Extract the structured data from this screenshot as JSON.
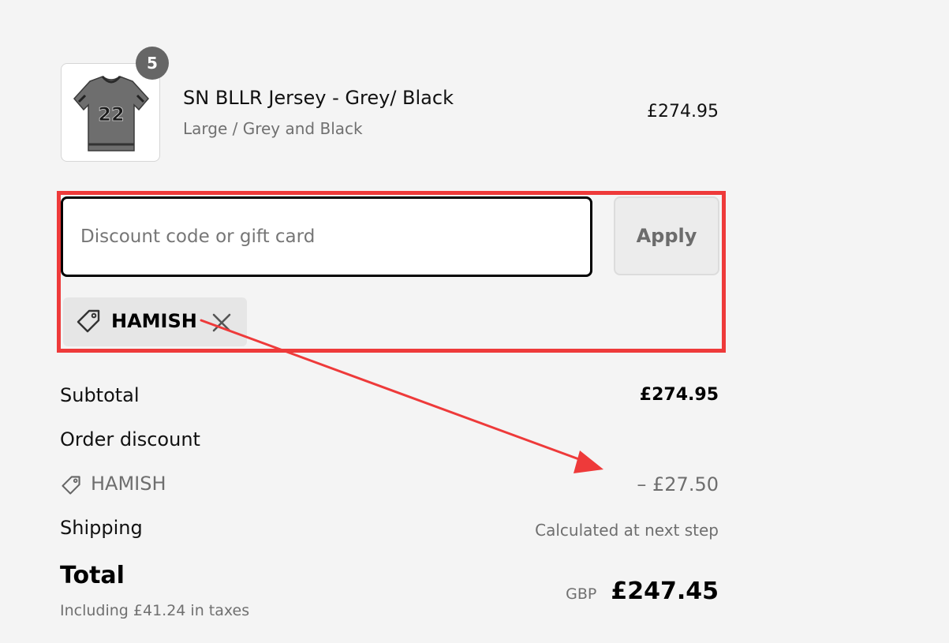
{
  "product": {
    "quantity": "5",
    "name": "SN BLLR Jersey - Grey/ Black",
    "variant": "Large / Grey and Black",
    "price": "£274.95",
    "jersey_number": "22"
  },
  "discount": {
    "placeholder": "Discount code or gift card",
    "value": "",
    "apply_label": "Apply",
    "applied_code": "HAMISH"
  },
  "summary": {
    "subtotal_label": "Subtotal",
    "subtotal_value": "£274.95",
    "order_discount_label": "Order discount",
    "discount_code": "HAMISH",
    "discount_amount": "– £27.50",
    "shipping_label": "Shipping",
    "shipping_value": "Calculated at next step",
    "total_label": "Total",
    "tax_note": "Including £41.24 in taxes",
    "currency": "GBP",
    "total_value": "£247.45"
  },
  "colors": {
    "annotation": "#ee3a3a",
    "background": "#f4f4f4",
    "muted_text": "#707070"
  },
  "icons": [
    "tag-icon",
    "close-icon",
    "arrow-annotation"
  ]
}
